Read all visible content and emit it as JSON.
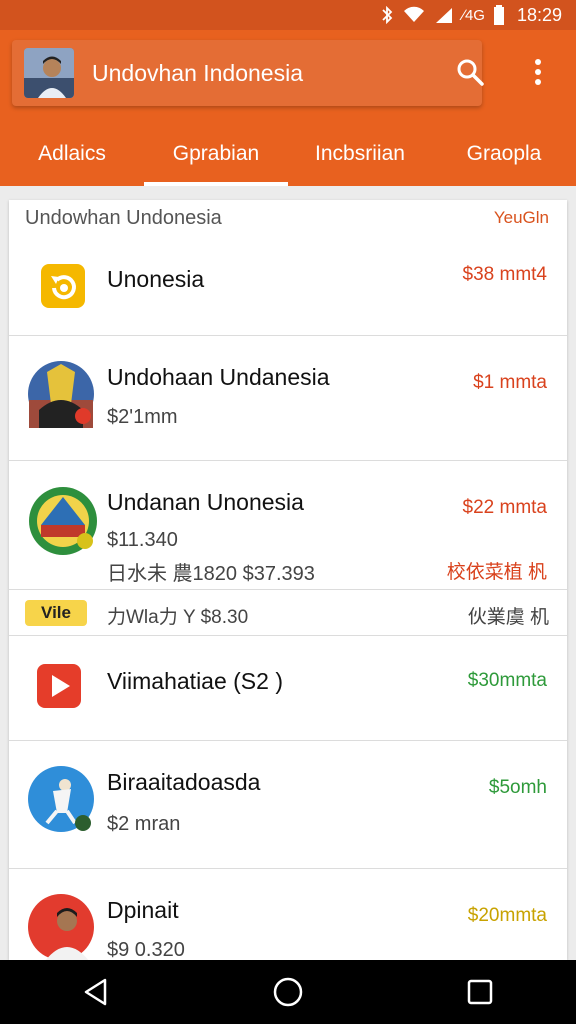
{
  "status_bar": {
    "network": "∕4G",
    "time": "18:29"
  },
  "app_bar": {
    "title": "Undovhan Indonesia"
  },
  "tabs": [
    {
      "label": "Adlaics",
      "active": false
    },
    {
      "label": "Gprabian",
      "active": true
    },
    {
      "label": "Incbsriian",
      "active": false
    },
    {
      "label": "Graopla",
      "active": false
    }
  ],
  "list_header": {
    "title": "Undowhan Undonesia",
    "right": "YeuGln"
  },
  "rows": [
    {
      "title": "Unonesia",
      "subtitle": "",
      "subtitle2": "",
      "price": "$38 mmt4",
      "price_color": "#d9421d",
      "icon": "folder-refresh-icon"
    },
    {
      "title": "Undohaan Undanesia",
      "subtitle": "$2ʹ1mm",
      "subtitle2": "",
      "price": "$1 mmtа",
      "price_color": "#d9421d",
      "icon": "avatar-icon"
    },
    {
      "title": "Undanan Unonesia",
      "subtitle": "$11.340",
      "subtitle2": "日水未 農1820  $37.393",
      "price": "$22 mmta",
      "price_color": "#d9421d",
      "price2": "校依菜植 杋",
      "icon": "emblem-icon"
    },
    {
      "title": "Viimahatiae (S2 )",
      "subtitle": "",
      "subtitle2": "",
      "price": "$30mmta",
      "price_color": "#2e9a3a",
      "icon": "play-icon"
    },
    {
      "title": "Biraaitadoasda",
      "subtitle": "$2  mran",
      "subtitle2": "",
      "price": "$5omh",
      "price_color": "#2e9a3a",
      "icon": "athlete-avatar-icon"
    },
    {
      "title": "Dpinait",
      "subtitle": "$9 0.320",
      "subtitle2": "",
      "price": "$20mmta",
      "price_color": "#c8a200",
      "icon": "person-avatar-icon"
    }
  ],
  "strip": {
    "badge": "Vile",
    "text": "力Wla力 Y $8.30",
    "right": "伙業虞 机"
  },
  "nav": {
    "back": "back-icon",
    "home": "home-icon",
    "recents": "recents-icon"
  }
}
